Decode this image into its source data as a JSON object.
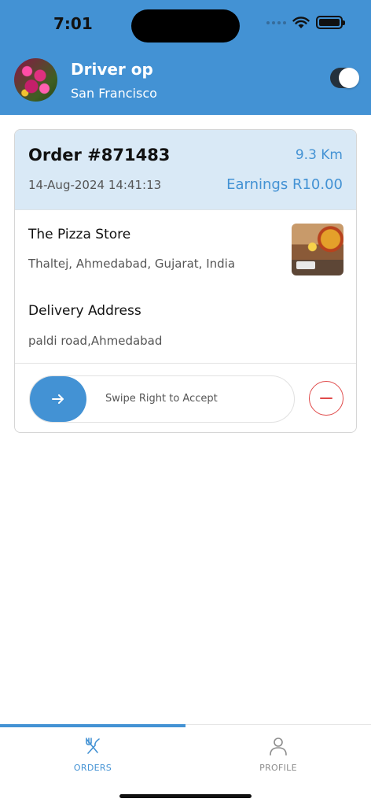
{
  "status_bar": {
    "time": "7:01"
  },
  "header": {
    "driver_name": "Driver op",
    "city": "San Francisco",
    "online_toggle": "on"
  },
  "order": {
    "number": "Order #871483",
    "distance": "9.3 Km",
    "datetime": "14-Aug-2024 14:41:13",
    "earnings": "Earnings R10.00",
    "store_name": "The Pizza Store",
    "store_address": "Thaltej, Ahmedabad, Gujarat, India",
    "delivery_title": "Delivery Address",
    "delivery_address": "paldi road,Ahmedabad",
    "swipe_label": "Swipe Right to Accept"
  },
  "nav": {
    "tabs": [
      {
        "label": "ORDERS",
        "icon": "fork-knife-icon",
        "active": true
      },
      {
        "label": "PROFILE",
        "icon": "person-icon",
        "active": false
      }
    ]
  },
  "colors": {
    "accent": "#4392d4",
    "card_header": "#d9e9f6",
    "reject": "#e04a4a"
  }
}
